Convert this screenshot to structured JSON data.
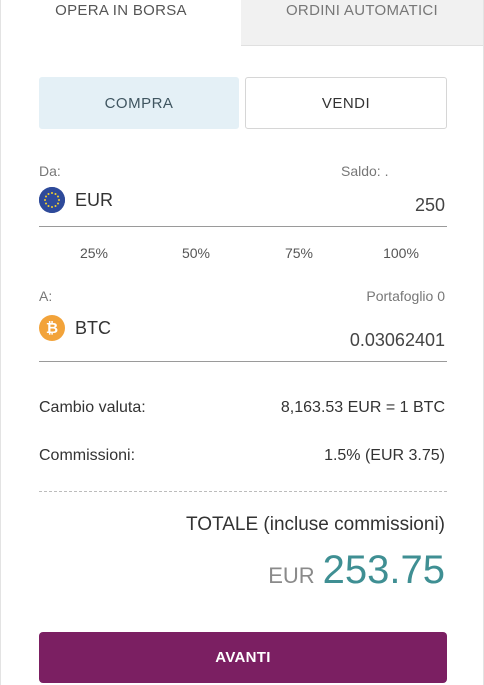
{
  "tabs": [
    {
      "label": "OPERA IN BORSA",
      "active": true
    },
    {
      "label": "ORDINI AUTOMATICI",
      "active": false
    }
  ],
  "toggle": {
    "buy_label": "COMPRA",
    "sell_label": "VENDI",
    "selected": "buy"
  },
  "from": {
    "label": "Da:",
    "balance_label": "Saldo: .",
    "currency": "EUR",
    "icon": "eur-flag-icon",
    "amount": "250"
  },
  "percentages": [
    "25%",
    "50%",
    "75%",
    "100%"
  ],
  "to": {
    "label": "A:",
    "wallet_label": "Portafoglio 0",
    "currency": "BTC",
    "icon": "bitcoin-icon",
    "amount": "0.03062401"
  },
  "exchange": {
    "label": "Cambio valuta:",
    "value": "8,163.53 EUR = 1 BTC"
  },
  "fees": {
    "label": "Commissioni:",
    "value": "1.5% (EUR 3.75)"
  },
  "total": {
    "label": "TOTALE (incluse commissioni)",
    "currency": "EUR",
    "amount": "253.75"
  },
  "next_button": "AVANTI",
  "colors": {
    "accent": "#7b1f62",
    "total_amount": "#3f8f93",
    "buy_selected_bg": "#e4f0f6",
    "eur_icon": "#2e4a9a",
    "btc_icon": "#f2a33a"
  }
}
